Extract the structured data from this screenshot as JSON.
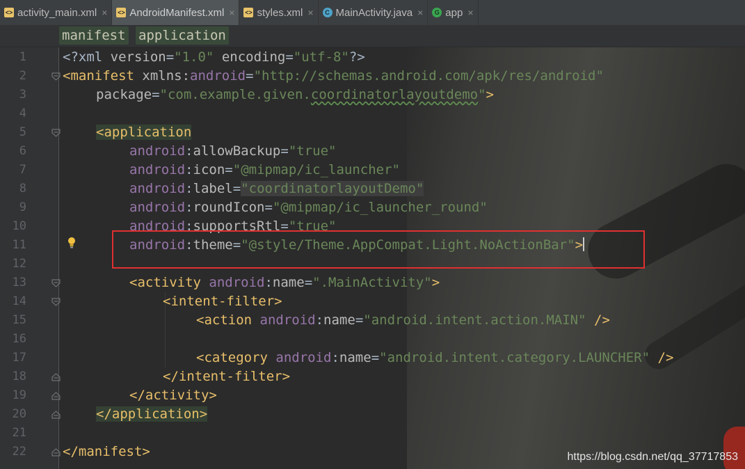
{
  "tabs": [
    {
      "label": "activity_main.xml",
      "icon": "xml-file-icon",
      "active": false
    },
    {
      "label": "AndroidManifest.xml",
      "icon": "manifest-file-icon",
      "active": true
    },
    {
      "label": "styles.xml",
      "icon": "xml-file-icon",
      "active": false
    },
    {
      "label": "MainActivity.java",
      "icon": "java-class-icon",
      "active": false
    },
    {
      "label": "app",
      "icon": "gradle-module-icon",
      "active": false
    }
  ],
  "breadcrumb": {
    "item1": "manifest",
    "item2": "application"
  },
  "line_numbers": [
    "1",
    "2",
    "3",
    "4",
    "5",
    "6",
    "7",
    "8",
    "9",
    "10",
    "11",
    "12",
    "13",
    "14",
    "15",
    "16",
    "17",
    "18",
    "19",
    "20",
    "21",
    "22"
  ],
  "code": {
    "l1": {
      "a": "<?xml ",
      "b": "version",
      "c": "=",
      "d": "\"1.0\"",
      "e": " encoding",
      "f": "=",
      "g": "\"utf-8\"",
      "h": "?>"
    },
    "l2": {
      "a": "<manifest ",
      "b": "xmlns",
      "c": ":",
      "d": "android",
      "e": "=",
      "f": "\"http://schemas.android.com/apk/res/android\""
    },
    "l3": {
      "a": "package",
      "b": "=",
      "c": "\"com.example.given.",
      "d": "coordinatorlayoutdemo",
      "e": "\"",
      "f": ">"
    },
    "l5": {
      "a": "<application"
    },
    "l6": {
      "ns": "android",
      "colon": ":",
      "attr": "allowBackup",
      "eq": "=",
      "val": "\"true\""
    },
    "l7": {
      "ns": "android",
      "colon": ":",
      "attr": "icon",
      "eq": "=",
      "val": "\"@mipmap/ic_launcher\""
    },
    "l8": {
      "ns": "android",
      "colon": ":",
      "attr": "label",
      "eq": "=",
      "val": "\"coordinatorlayoutDemo\""
    },
    "l9": {
      "ns": "android",
      "colon": ":",
      "attr": "roundIcon",
      "eq": "=",
      "val": "\"@mipmap/ic_launcher_round\""
    },
    "l10": {
      "ns": "android",
      "colon": ":",
      "attr": "supportsRtl",
      "eq": "=",
      "val": "\"true\""
    },
    "l11": {
      "ns": "android",
      "colon": ":",
      "attr": "theme",
      "eq": "=",
      "val": "\"@style/Theme.AppCompat.Light.NoActionBar\"",
      "end": ">"
    },
    "l13": {
      "a": "<activity ",
      "ns": "android",
      "colon": ":",
      "attr": "name",
      "eq": "=",
      "val": "\".MainActivity\"",
      "end": ">"
    },
    "l14": {
      "a": "<intent-filter>"
    },
    "l15": {
      "a": "<action ",
      "ns": "android",
      "colon": ":",
      "attr": "name",
      "eq": "=",
      "val": "\"android.intent.action.MAIN\"",
      "end": " />"
    },
    "l17": {
      "a": "<category ",
      "ns": "android",
      "colon": ":",
      "attr": "name",
      "eq": "=",
      "val": "\"android.intent.category.LAUNCHER\"",
      "end": " />"
    },
    "l18": {
      "a": "</intent-filter>"
    },
    "l19": {
      "a": "</activity>"
    },
    "l20": {
      "a": "</application>"
    },
    "l22": {
      "a": "</manifest>"
    }
  },
  "watermark": "https://blog.csdn.net/qq_37717853",
  "colors": {
    "highlight_box": "#e03030",
    "tag": "#e8bf6a",
    "namespace": "#9876aa",
    "string": "#6a8759"
  }
}
